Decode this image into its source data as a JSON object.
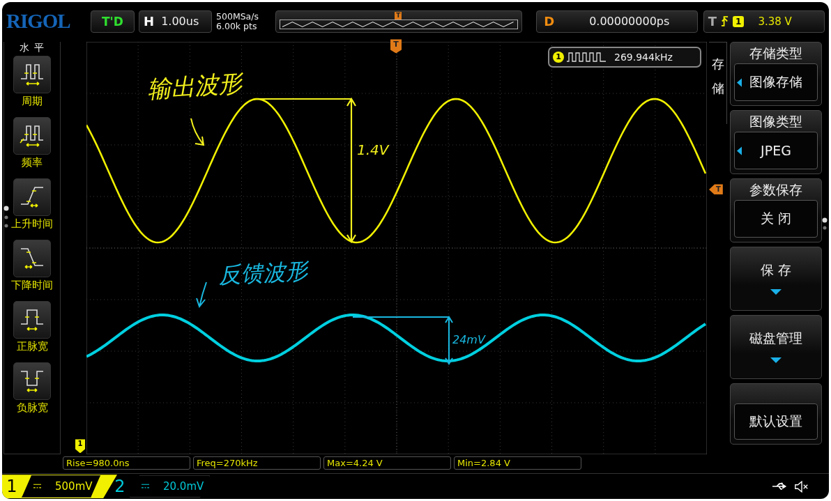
{
  "header": {
    "brand": "RIGOL",
    "run_state": "T'D",
    "horizontal": {
      "label": "H",
      "value": "1.00us"
    },
    "sample_rate": "500MSa/s",
    "memory_depth": "6.00k pts",
    "overview_marker": "T",
    "delay": {
      "label": "D",
      "value": "0.00000000ps"
    },
    "trigger": {
      "label": "T",
      "source": "1",
      "level": "3.38 V"
    }
  },
  "left_menu": {
    "title": "水 平",
    "items": [
      {
        "kind": "period",
        "label": "周期"
      },
      {
        "kind": "frequency",
        "label": "频率"
      },
      {
        "kind": "rise",
        "label": "上升时间"
      },
      {
        "kind": "fall",
        "label": "下降时间"
      },
      {
        "kind": "positive_width",
        "label": "正脉宽"
      },
      {
        "kind": "negative_width",
        "label": "负脉宽"
      }
    ]
  },
  "display": {
    "counter": {
      "channel": "1",
      "value": "269.944kHz"
    },
    "trigger_marker": "T",
    "trigger_level_marker": "T",
    "ground_marker": "1",
    "annotations": [
      {
        "kind": "label",
        "text": "输出波形",
        "color": "#f2f01c"
      },
      {
        "kind": "label",
        "text": "1.4V",
        "color": "#f2f01c"
      },
      {
        "kind": "label",
        "text": "反馈波形",
        "color": "#19b8e0"
      },
      {
        "kind": "label",
        "text": "24mV",
        "color": "#19b8e0"
      }
    ]
  },
  "right_menu": {
    "title": "存储",
    "items": [
      {
        "kind": "option",
        "label": "存储类型",
        "value": "图像存储",
        "cycle_arrow": true
      },
      {
        "kind": "option",
        "label": "图像类型",
        "value": "JPEG",
        "cycle_arrow": true
      },
      {
        "kind": "option",
        "label": "参数保存",
        "value": "关 闭",
        "cycle_arrow": false
      },
      {
        "kind": "submenu",
        "label": "保 存"
      },
      {
        "kind": "submenu",
        "label": "磁盘管理"
      },
      {
        "kind": "action",
        "value": "默认设置"
      }
    ]
  },
  "measurements": [
    "Rise=980.0ns",
    "Freq=270kHz",
    "Max=4.24 V",
    "Min=2.84 V"
  ],
  "channels": [
    {
      "number": "1",
      "scale": "500mV",
      "color": "#f0f000",
      "selected": true
    },
    {
      "number": "2",
      "scale": "20.0mV",
      "color": "#00c8d8",
      "selected": false
    }
  ]
}
